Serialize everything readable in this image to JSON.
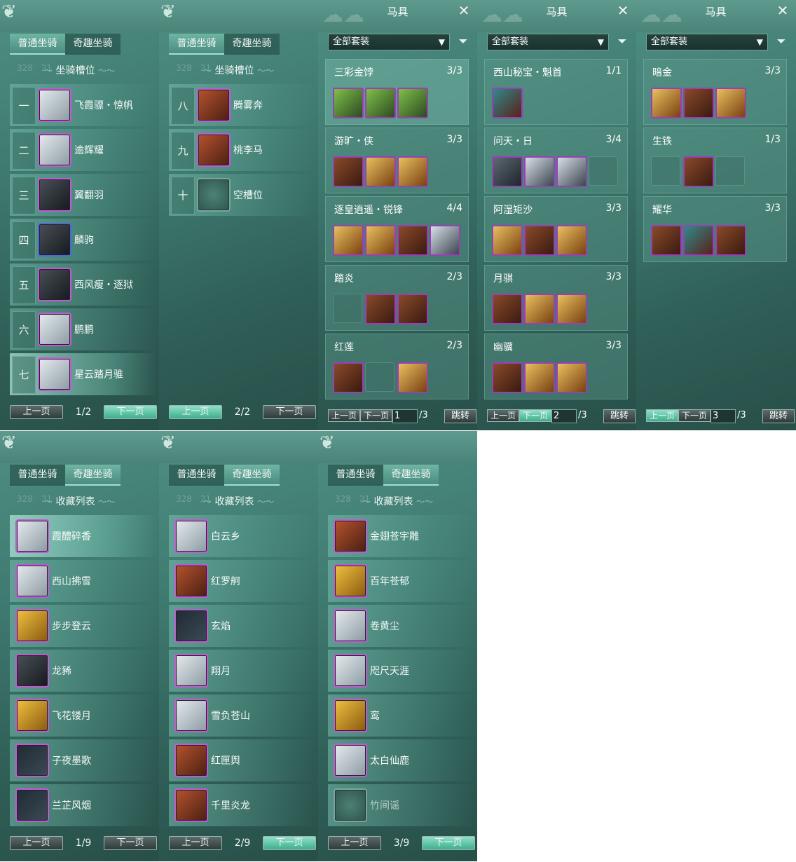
{
  "tabs": {
    "normal": "普通坐骑",
    "fun": "奇趣坐骑"
  },
  "section": {
    "slot_title": "坐骑槽位",
    "collect_title": "收藏列表",
    "faint_nums": "328　21"
  },
  "pager": {
    "prev": "上一页",
    "next": "下一页"
  },
  "equip": {
    "title": "马具",
    "filter": "全部套装",
    "jump": "跳转",
    "prev": "上一页",
    "next": "下一页"
  },
  "slots1": {
    "page": "1/2",
    "items": [
      {
        "num": "一",
        "name": "飞霞骠・惊帆"
      },
      {
        "num": "二",
        "name": "逾辉耀"
      },
      {
        "num": "三",
        "name": "翼翻羽"
      },
      {
        "num": "四",
        "name": "麟驹"
      },
      {
        "num": "五",
        "name": "西风瘦・逐狱"
      },
      {
        "num": "六",
        "name": "鹏鹏"
      },
      {
        "num": "七",
        "name": "星云踏月骓"
      }
    ]
  },
  "slots2": {
    "page": "2/2",
    "items": [
      {
        "num": "八",
        "name": "腾雾奔"
      },
      {
        "num": "九",
        "name": "桃李马"
      },
      {
        "num": "十",
        "name": "空槽位"
      }
    ]
  },
  "sets1": {
    "page": "1",
    "total": "/3",
    "items": [
      {
        "name": "三彩金饽",
        "count": "3/3"
      },
      {
        "name": "游旷・侠",
        "count": "3/3"
      },
      {
        "name": "逐皇逍遥・锐锋",
        "count": "4/4"
      },
      {
        "name": "踏炎",
        "count": "2/3"
      },
      {
        "name": "红莲",
        "count": "2/3"
      }
    ]
  },
  "sets2": {
    "page": "2",
    "total": "/3",
    "items": [
      {
        "name": "西山秘宝・魁首",
        "count": "1/1"
      },
      {
        "name": "问天・日",
        "count": "3/4"
      },
      {
        "name": "阿湿矩沙",
        "count": "3/3"
      },
      {
        "name": "月骐",
        "count": "3/3"
      },
      {
        "name": "幽骥",
        "count": "3/3"
      }
    ]
  },
  "sets3": {
    "page": "3",
    "total": "/3",
    "items": [
      {
        "name": "暗金",
        "count": "3/3"
      },
      {
        "name": "生铁",
        "count": "1/3"
      },
      {
        "name": "耀华",
        "count": "3/3"
      }
    ]
  },
  "collect1": {
    "page": "1/9",
    "items": [
      "霞醴碎香",
      "西山拂雪",
      "步步登云",
      "龙豨",
      "飞花镂月",
      "子夜墨歌",
      "兰芷风烟"
    ]
  },
  "collect2": {
    "page": "2/9",
    "items": [
      "白云乡",
      "红罗舸",
      "玄焰",
      "翔月",
      "雪负苍山",
      "红匣舆",
      "千里炎龙"
    ]
  },
  "collect3": {
    "page": "3/9",
    "items": [
      "金翅苍宇雕",
      "百年苍郁",
      "卷黄尘",
      "咫尺天涯",
      "鸾",
      "太白仙鹿",
      "竹间谣"
    ]
  },
  "colors": {
    "panel": "#3f7a70",
    "border": "#c05bd0",
    "highlight": "#3fae8d"
  }
}
